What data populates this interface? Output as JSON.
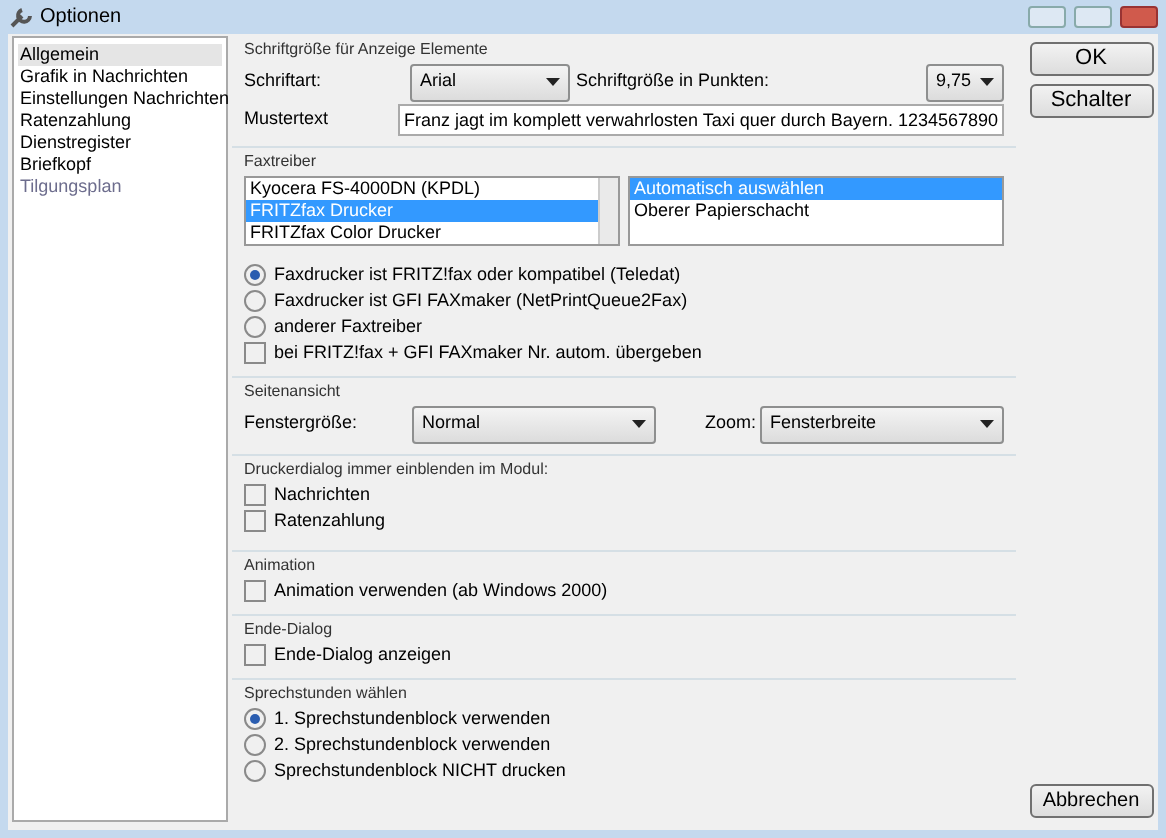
{
  "window": {
    "title": "Optionen"
  },
  "sidebar": {
    "items": [
      {
        "label": "Allgemein",
        "selected": true,
        "disabled": false
      },
      {
        "label": "Grafik in Nachrichten",
        "selected": false,
        "disabled": false
      },
      {
        "label": "Einstellungen Nachrichten",
        "selected": false,
        "disabled": false
      },
      {
        "label": "Ratenzahlung",
        "selected": false,
        "disabled": false
      },
      {
        "label": "Dienstregister",
        "selected": false,
        "disabled": false
      },
      {
        "label": "Briefkopf",
        "selected": false,
        "disabled": false
      },
      {
        "label": "Tilgungsplan",
        "selected": false,
        "disabled": true
      }
    ]
  },
  "font_section": {
    "title": "Schriftgröße für Anzeige Elemente",
    "font_label": "Schriftart:",
    "font_value": "Arial",
    "size_label": "Schriftgröße in Punkten:",
    "size_value": "9,75",
    "sample_label": "Mustertext",
    "sample_value": "Franz jagt im komplett verwahrlosten Taxi quer durch Bayern. 1234567890"
  },
  "fax_section": {
    "title": "Faxtreiber",
    "printers": [
      {
        "label": "Kyocera FS-4000DN (KPDL)",
        "selected": false
      },
      {
        "label": "FRITZfax Drucker",
        "selected": true
      },
      {
        "label": "FRITZfax Color Drucker",
        "selected": false
      }
    ],
    "trays": [
      {
        "label": "Automatisch auswählen",
        "selected": true
      },
      {
        "label": "Oberer Papierschacht",
        "selected": false
      }
    ],
    "options": [
      {
        "kind": "radio",
        "label": "Faxdrucker ist FRITZ!fax oder kompatibel (Teledat)",
        "checked": true
      },
      {
        "kind": "radio",
        "label": "Faxdrucker ist GFI FAXmaker (NetPrintQueue2Fax)",
        "checked": false
      },
      {
        "kind": "radio",
        "label": "anderer Faxtreiber",
        "checked": false
      },
      {
        "kind": "checkbox",
        "label": "bei FRITZ!fax + GFI FAXmaker Nr. autom. übergeben",
        "checked": false
      }
    ]
  },
  "page_view": {
    "title": "Seitenansicht",
    "size_label": "Fenstergröße:",
    "size_value": "Normal",
    "zoom_label": "Zoom:",
    "zoom_value": "Fensterbreite"
  },
  "groups": [
    {
      "title": "Druckerdialog immer einblenden im Modul:",
      "options": [
        {
          "kind": "checkbox",
          "label": "Nachrichten",
          "checked": false
        },
        {
          "kind": "checkbox",
          "label": "Ratenzahlung",
          "checked": false
        }
      ]
    },
    {
      "title": "Animation",
      "options": [
        {
          "kind": "checkbox",
          "label": "Animation verwenden (ab Windows 2000)",
          "checked": false
        }
      ]
    },
    {
      "title": "Ende-Dialog",
      "options": [
        {
          "kind": "checkbox",
          "label": "Ende-Dialog anzeigen",
          "checked": false
        }
      ]
    },
    {
      "title": "Sprechstunden wählen",
      "options": [
        {
          "kind": "radio",
          "label": "1. Sprechstundenblock verwenden",
          "checked": true
        },
        {
          "kind": "radio",
          "label": "2. Sprechstundenblock verwenden",
          "checked": false
        },
        {
          "kind": "radio",
          "label": "Sprechstundenblock NICHT drucken",
          "checked": false
        }
      ]
    }
  ],
  "buttons": [
    "OK",
    "Schalter"
  ],
  "cancel_button": "Abbrechen"
}
